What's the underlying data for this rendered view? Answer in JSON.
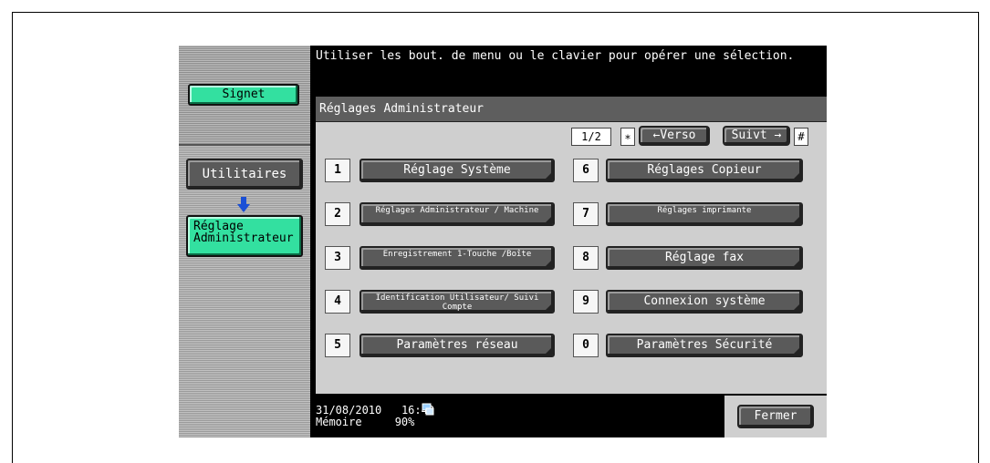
{
  "header": {
    "message": "Utiliser les bout. de menu ou le clavier pour opérer une sélection."
  },
  "sidebar": {
    "signet_label": "Signet",
    "utilitaires_label": "Utilitaires",
    "admin_label_line1": "Réglage",
    "admin_label_line2": "Administrateur"
  },
  "panel": {
    "title": "Réglages Administrateur",
    "page_indicator": "1/2",
    "star_key": "∗",
    "hash_key": "#",
    "prev_label": "←Verso",
    "next_label": "Suivt →"
  },
  "menu": {
    "left": [
      {
        "num": "1",
        "label": "Réglage Système"
      },
      {
        "num": "2",
        "label": "Réglages Administrateur / Machine"
      },
      {
        "num": "3",
        "label": "Enregistrement 1-Touche /Boîte"
      },
      {
        "num": "4",
        "label": "Identification Utilisateur/ Suivi Compte"
      },
      {
        "num": "5",
        "label": "Paramètres réseau"
      }
    ],
    "right": [
      {
        "num": "6",
        "label": "Réglages Copieur"
      },
      {
        "num": "7",
        "label": "Réglages imprimante"
      },
      {
        "num": "8",
        "label": "Réglage fax"
      },
      {
        "num": "9",
        "label": "Connexion système"
      },
      {
        "num": "0",
        "label": "Paramètres Sécurité"
      }
    ]
  },
  "status": {
    "date": "31/08/2010",
    "time": "16:42",
    "memory_label": "Mémoire",
    "memory_value": "90%"
  },
  "footer": {
    "close_label": "Fermer"
  },
  "colors": {
    "accent_green": "#33e0a0",
    "button_grey": "#5a5a5a"
  }
}
